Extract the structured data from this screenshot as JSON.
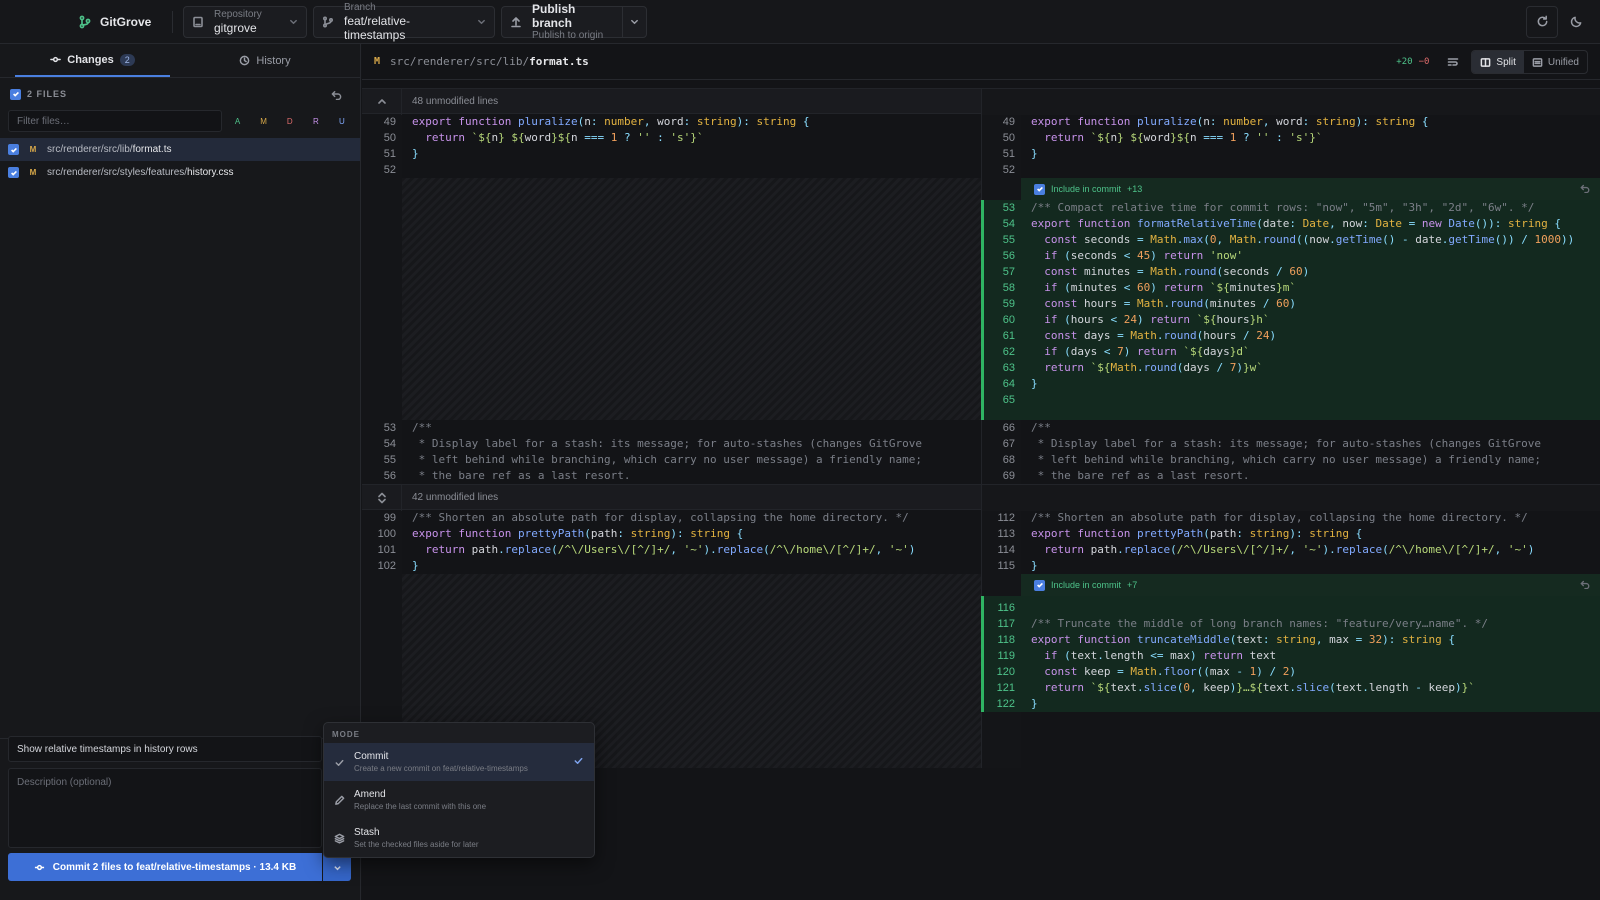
{
  "app": {
    "name": "GitGrove"
  },
  "toolbar": {
    "repo_label": "Repository",
    "repo_value": "gitgrove",
    "branch_label": "Branch",
    "branch_value": "feat/relative-timestamps",
    "publish_label": "Publish branch",
    "publish_sub": "Publish to origin"
  },
  "sidebar": {
    "tab_changes": "Changes",
    "changes_count": "2",
    "tab_history": "History",
    "files_header": "2 FILES",
    "filter_placeholder": "Filter files…",
    "filters": [
      "A",
      "M",
      "D",
      "R",
      "U"
    ],
    "files": [
      {
        "status": "M",
        "dir": "src/renderer/src/lib/",
        "name": "format.ts"
      },
      {
        "status": "M",
        "dir": "src/renderer/src/styles/features/",
        "name": "history.css"
      }
    ],
    "summary": "Show relative timestamps in history rows",
    "description_placeholder": "Description (optional)",
    "commit_button": "Commit 2 files to feat/relative-timestamps · 13.4 KB"
  },
  "menu": {
    "header": "MODE",
    "items": [
      {
        "label": "Commit",
        "desc": "Create a new commit on feat/relative-timestamps",
        "selected": true
      },
      {
        "label": "Amend",
        "desc": "Replace the last commit with this one"
      },
      {
        "label": "Stash",
        "desc": "Set the checked files aside for later"
      }
    ]
  },
  "diff": {
    "status": "M",
    "dir": "src/renderer/src/lib/",
    "file": "format.ts",
    "added": "+20",
    "removed": "−0",
    "split_label": "Split",
    "unified_label": "Unified",
    "hunk1": "48 unmodified lines",
    "hunk2": "42 unmodified lines",
    "include_label": "Include in commit",
    "include1_count": "+13",
    "include2_count": "+7"
  },
  "colors": {
    "accent": "#3d6fd6",
    "added": "#2fb463",
    "modified": "#d9a94a"
  }
}
